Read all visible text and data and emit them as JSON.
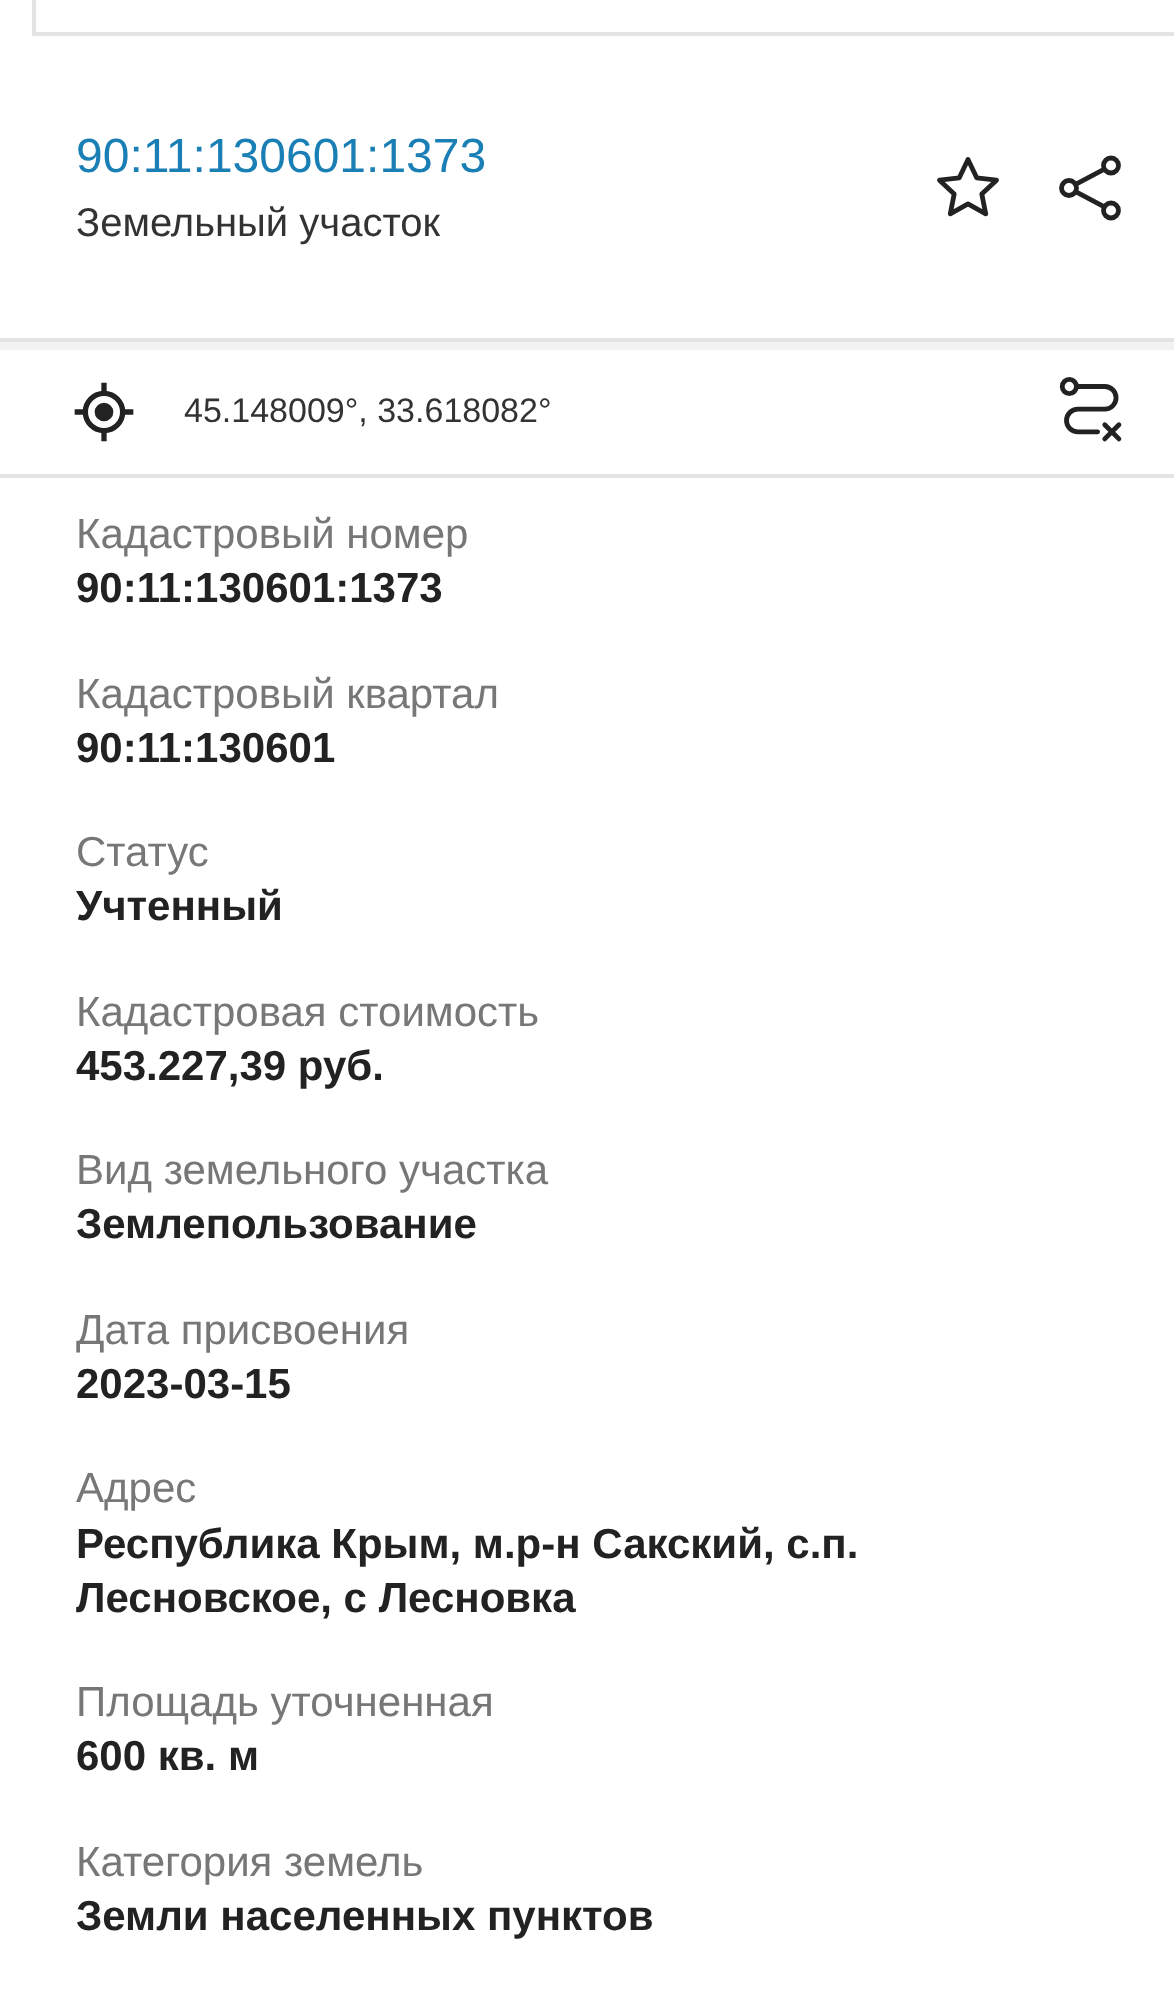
{
  "header": {
    "cadastral_link": "90:11:130601:1373",
    "subtitle": "Земельный участок",
    "favorite": false
  },
  "coordinates": {
    "text": "45.148009°, 33.618082°"
  },
  "fields": [
    {
      "label": "Кадастровый номер",
      "value": "90:11:130601:1373"
    },
    {
      "label": "Кадастровый квартал",
      "value": "90:11:130601"
    },
    {
      "label": "Статус",
      "value": "Учтенный"
    },
    {
      "label": "Кадастровая стоимость",
      "value": "453.227,39 руб."
    },
    {
      "label": "Вид земельного участка",
      "value": "Землепользование"
    },
    {
      "label": "Дата присвоения",
      "value": "2023-03-15"
    },
    {
      "label": "Адрес",
      "value": "Республика Крым, м.р-н Сакский, с.п. Лесновское, с Лесновка"
    },
    {
      "label": "Площадь уточненная",
      "value": "600 кв. м"
    },
    {
      "label": "Категория земель",
      "value": "Земли населенных пунктов"
    }
  ]
}
